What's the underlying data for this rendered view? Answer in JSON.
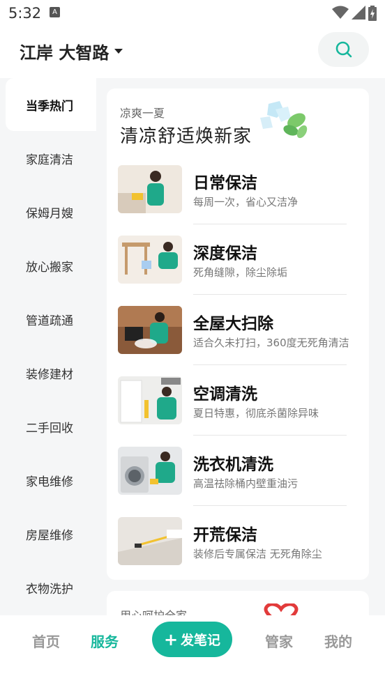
{
  "status_bar": {
    "time": "5:32",
    "notification_icon": "A"
  },
  "header": {
    "location": "江岸 大智路",
    "search_icon": "search-icon"
  },
  "sidebar": {
    "items": [
      {
        "label": "当季热门",
        "active": true
      },
      {
        "label": "家庭清洁"
      },
      {
        "label": "保姆月嫂"
      },
      {
        "label": "放心搬家"
      },
      {
        "label": "管道疏通"
      },
      {
        "label": "装修建材"
      },
      {
        "label": "二手回收"
      },
      {
        "label": "家电维修"
      },
      {
        "label": "房屋维修"
      },
      {
        "label": "衣物洗护"
      }
    ]
  },
  "card": {
    "subtitle": "凉爽一夏",
    "title": "清凉舒适焕新家",
    "services": [
      {
        "name": "日常保洁",
        "desc": "每周一次，省心又洁净"
      },
      {
        "name": "深度保洁",
        "desc": "死角缝隙，除尘除垢"
      },
      {
        "name": "全屋大扫除",
        "desc": "适合久未打扫，360度无死角清洁"
      },
      {
        "name": "空调清洗",
        "desc": "夏日特惠，彻底杀菌除异味"
      },
      {
        "name": "洗衣机清洗",
        "desc": "高温祛除桶内壁重油污"
      },
      {
        "name": "开荒保洁",
        "desc": "装修后专属保洁 无死角除尘"
      }
    ]
  },
  "card2": {
    "subtitle": "用心呵护全家"
  },
  "bottom_nav": {
    "home": "首页",
    "service": "服务",
    "post": "发笔记",
    "butler": "管家",
    "mine": "我的"
  },
  "colors": {
    "accent": "#16b79c"
  }
}
